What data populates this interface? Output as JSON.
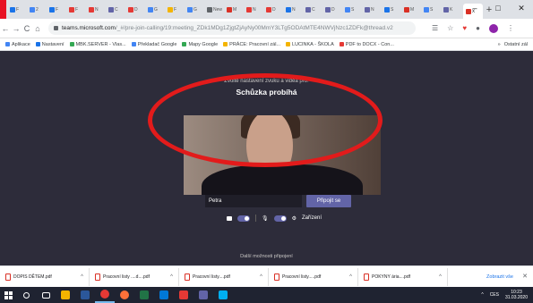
{
  "browser": {
    "tabs": [
      {
        "label": "F",
        "color": "#1a73e8"
      },
      {
        "label": "2",
        "color": "#4285f4"
      },
      {
        "label": "F",
        "color": "#1a73e8"
      },
      {
        "label": "F",
        "color": "#e53935"
      },
      {
        "label": "N",
        "color": "#e53935"
      },
      {
        "label": "C",
        "color": "#6264a7"
      },
      {
        "label": "D",
        "color": "#e53935"
      },
      {
        "label": "G",
        "color": "#4285f4"
      },
      {
        "label": "F",
        "color": "#f4b400"
      },
      {
        "label": "G",
        "color": "#4285f4"
      },
      {
        "label": "New",
        "color": "#5f6368"
      },
      {
        "label": "M",
        "color": "#d93025"
      },
      {
        "label": "N",
        "color": "#e53935"
      },
      {
        "label": "D",
        "color": "#e53935"
      },
      {
        "label": "N",
        "color": "#1a73e8"
      },
      {
        "label": "C",
        "color": "#6264a7"
      },
      {
        "label": "D",
        "color": "#6264a7"
      },
      {
        "label": "S",
        "color": "#4285f4"
      },
      {
        "label": "N",
        "color": "#6264a7"
      },
      {
        "label": "S",
        "color": "#1a73e8"
      },
      {
        "label": "M",
        "color": "#d93025"
      },
      {
        "label": "S",
        "color": "#4285f4"
      },
      {
        "label": "K",
        "color": "#6264a7"
      }
    ],
    "active_tab": {
      "label": "x",
      "color": "#d93025"
    },
    "new_tab_label": "+",
    "window_controls": [
      "–",
      "□",
      "✕"
    ],
    "nav": [
      "←",
      "→",
      "C",
      "⌂"
    ],
    "url_host": "teams.microsoft.com",
    "url_path": "/_#/pre-join-calling/19:meeting_ZDk1MDg1ZjgtZjAyNy00MmY3LTg5ODAtMTE4NWVjNzc1ZDFk@thread.v2",
    "extensions": [
      "☰",
      "☆",
      "♥",
      "●",
      "⋮"
    ],
    "bookmarks": [
      {
        "label": "Aplikace",
        "color": "#4285f4"
      },
      {
        "label": "Nastavení",
        "color": "#1a73e8"
      },
      {
        "label": "MBK.SERVER - Vlas...",
        "color": "#34a853"
      },
      {
        "label": "Překladač Google",
        "color": "#4285f4"
      },
      {
        "label": "Mapy Google",
        "color": "#34a853"
      },
      {
        "label": "PRÁCE: Pracovní zál...",
        "color": "#f4b400"
      },
      {
        "label": "LUCINKA - ŠKOLA",
        "color": "#f4b400"
      },
      {
        "label": "PDF to DOCX - Con...",
        "color": "#e53935"
      }
    ],
    "bookmarks_overflow": "»",
    "bookmarks_other": "Ostatní zál"
  },
  "teams": {
    "subtitle": "Zvolte nastavení zvuku a videa pro:",
    "meeting_title": "Schůzka probíhá",
    "name_value": "Petra",
    "join_label": "Připojit se",
    "devices_label": "Zařízení",
    "more_options": "Další možnosti připojení",
    "accent": "#6264a7"
  },
  "downloads": {
    "items": [
      {
        "name": "DOPIS DĚTEM.pdf"
      },
      {
        "name": "Pracovní listy ....d....pdf"
      },
      {
        "name": "Pracovní listy....pdf"
      },
      {
        "name": "Pracovní listy.....pdf"
      },
      {
        "name": "POKYNY      ária....pdf"
      }
    ],
    "show_all": "Zobrazit vše",
    "close": "✕"
  },
  "taskbar": {
    "apps": [
      {
        "name": "search",
        "color": "#ffffff"
      },
      {
        "name": "task-view",
        "color": "#ffffff"
      },
      {
        "name": "explorer",
        "color": "#f4b400"
      },
      {
        "name": "word",
        "color": "#2b579a"
      },
      {
        "name": "chrome",
        "color": "#e53935"
      },
      {
        "name": "firefox",
        "color": "#ff7139"
      },
      {
        "name": "excel",
        "color": "#217346"
      },
      {
        "name": "photos",
        "color": "#0078d7"
      },
      {
        "name": "media",
        "color": "#e53935"
      },
      {
        "name": "paint",
        "color": "#6264a7"
      },
      {
        "name": "skype",
        "color": "#00aff0"
      }
    ],
    "lang": "CES",
    "time": "10:23",
    "date": "31.03.2020"
  },
  "annotation_color": "#e21b1b"
}
